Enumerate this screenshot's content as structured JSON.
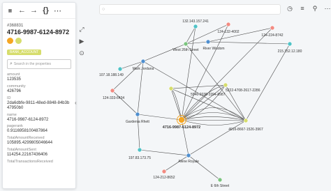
{
  "toolbar": {
    "back_icon": "←",
    "forward_icon": "→",
    "json_icon": "{}",
    "more_icon": "⋯"
  },
  "panel": {
    "node_id": "#368831",
    "node_title": "4716-9987-6124-8972",
    "tag": "BANK_ACCOUNT",
    "search_placeholder": "Search in the properties",
    "properties": [
      {
        "label": "amount",
        "value": "123535"
      },
      {
        "label": "community",
        "value": "426796"
      },
      {
        "label": "ID",
        "value": "2da6dbfe-9811-48ed-8848-84b3b47950b0"
      },
      {
        "label": "name",
        "value": "4716-9987-6124-8972"
      },
      {
        "label": "pagerank",
        "value": "0.9116958100487864"
      },
      {
        "label": "TotalAmountReceived",
        "value": "105895.4299805046644"
      },
      {
        "label": "TotalAmountSent",
        "value": "114254.22167436406"
      },
      {
        "label": "TotalTransactionsReceived",
        "value": ""
      }
    ]
  },
  "side_tools": {
    "fit_icon": "⤢",
    "play_icon": "▶",
    "settings_icon": "⊙"
  },
  "collapse_icon": "‹",
  "top_search": {
    "icon": "○",
    "placeholder": ""
  },
  "top_right": {
    "history_icon": "◷",
    "filter_icon": "≡",
    "layout_icon": "⚲",
    "more_icon": "⋯"
  },
  "graph": {
    "nodes": [
      {
        "label": "132.143.157.241"
      },
      {
        "label": "124-132-4002"
      },
      {
        "label": "124-224-8742"
      },
      {
        "label": "West 26th Street"
      },
      {
        "label": "River Wisdom"
      },
      {
        "label": "215.152.12.180"
      },
      {
        "label": "107.18.188.149"
      },
      {
        "label": "Mark Jordana"
      },
      {
        "label": "5222-4708-2617-2286"
      },
      {
        "label": "5546-2038-3394-8987"
      },
      {
        "label": "124-333-6434"
      },
      {
        "label": "Gardenia Rhett"
      },
      {
        "label": "4716-9987-6124-8972"
      },
      {
        "label": "4916-8667-1526-3967"
      },
      {
        "label": "197.83.173.75"
      },
      {
        "label": "Alene Royale"
      },
      {
        "label": "124-212-8652"
      },
      {
        "label": "E 6th Street"
      }
    ]
  },
  "colors": {
    "account": "#d6dd6c",
    "selected": "#f5a623",
    "phone": "#f28b82",
    "ip": "#4fc3c7",
    "person": "#4f8fcf",
    "street": "#7bc47f",
    "edge": "#4a4a4a",
    "node_stroke": "#ffffff"
  }
}
